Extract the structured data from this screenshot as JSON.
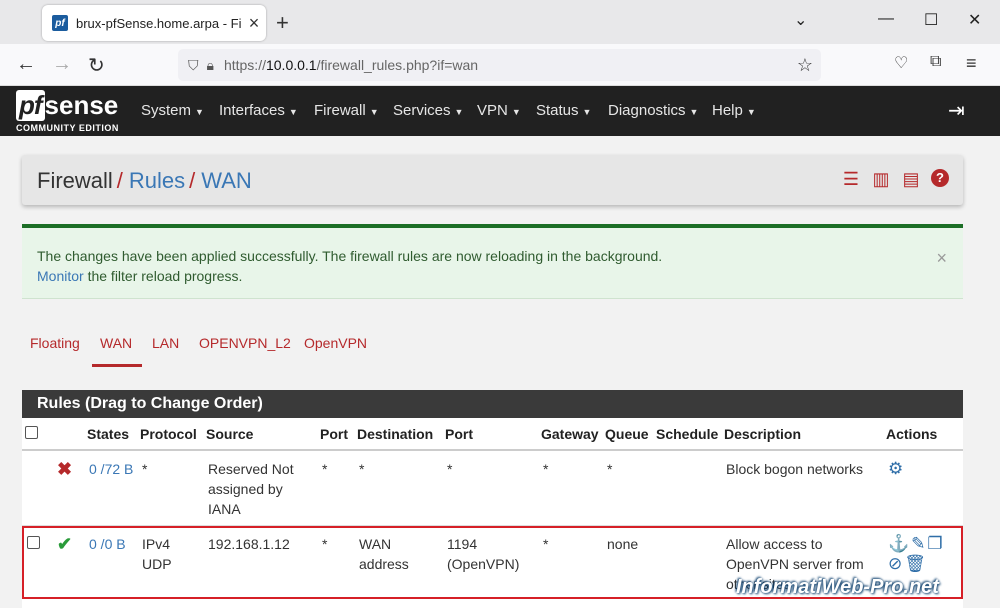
{
  "browser": {
    "tab_title": "brux-pfSense.home.arpa - Firew",
    "favicon_text": "pf",
    "url_prefix": "https://",
    "url_host": "10.0.0.1",
    "url_path": "/firewall_rules.php?if=wan"
  },
  "pfsense": {
    "logo_pf": "pf",
    "logo_sense": "sense",
    "edition": "COMMUNITY EDITION",
    "menu": [
      "System",
      "Interfaces",
      "Firewall",
      "Services",
      "VPN",
      "Status",
      "Diagnostics",
      "Help"
    ]
  },
  "breadcrumb": {
    "part1": "Firewall",
    "part2": "Rules",
    "part3": "WAN",
    "sep": "/"
  },
  "alert": {
    "line1": "The changes have been applied successfully. The firewall rules are now reloading in the background.",
    "link": "Monitor",
    "line2_rest": " the filter reload progress."
  },
  "tabs": [
    "Floating",
    "WAN",
    "LAN",
    "OPENVPN_L2",
    "OpenVPN"
  ],
  "active_tab": "WAN",
  "rules_title": "Rules (Drag to Change Order)",
  "columns": [
    "States",
    "Protocol",
    "Source",
    "Port",
    "Destination",
    "Port",
    "Gateway",
    "Queue",
    "Schedule",
    "Description",
    "Actions"
  ],
  "rows": [
    {
      "states": "0 /72 B",
      "protocol": "*",
      "source": "Reserved Not assigned by IANA",
      "sport": "*",
      "destination": "*",
      "dport": "*",
      "gateway": "*",
      "queue": "*",
      "schedule": "",
      "description": "Block bogon networks"
    },
    {
      "states": "0 /0 B",
      "protocol": "IPv4 UDP",
      "source": "192.168.1.12",
      "sport": "*",
      "destination": "WAN address",
      "dport": "1194 (OpenVPN)",
      "gateway": "*",
      "queue": "none",
      "schedule": "",
      "description": "Allow access to OpenVPN server from other sites"
    }
  ],
  "watermark": "InformatiWeb-Pro.net",
  "colors": {
    "accent": "#b5292b",
    "link": "#3a77b5",
    "header": "#212121",
    "success": "#1c6e26"
  }
}
